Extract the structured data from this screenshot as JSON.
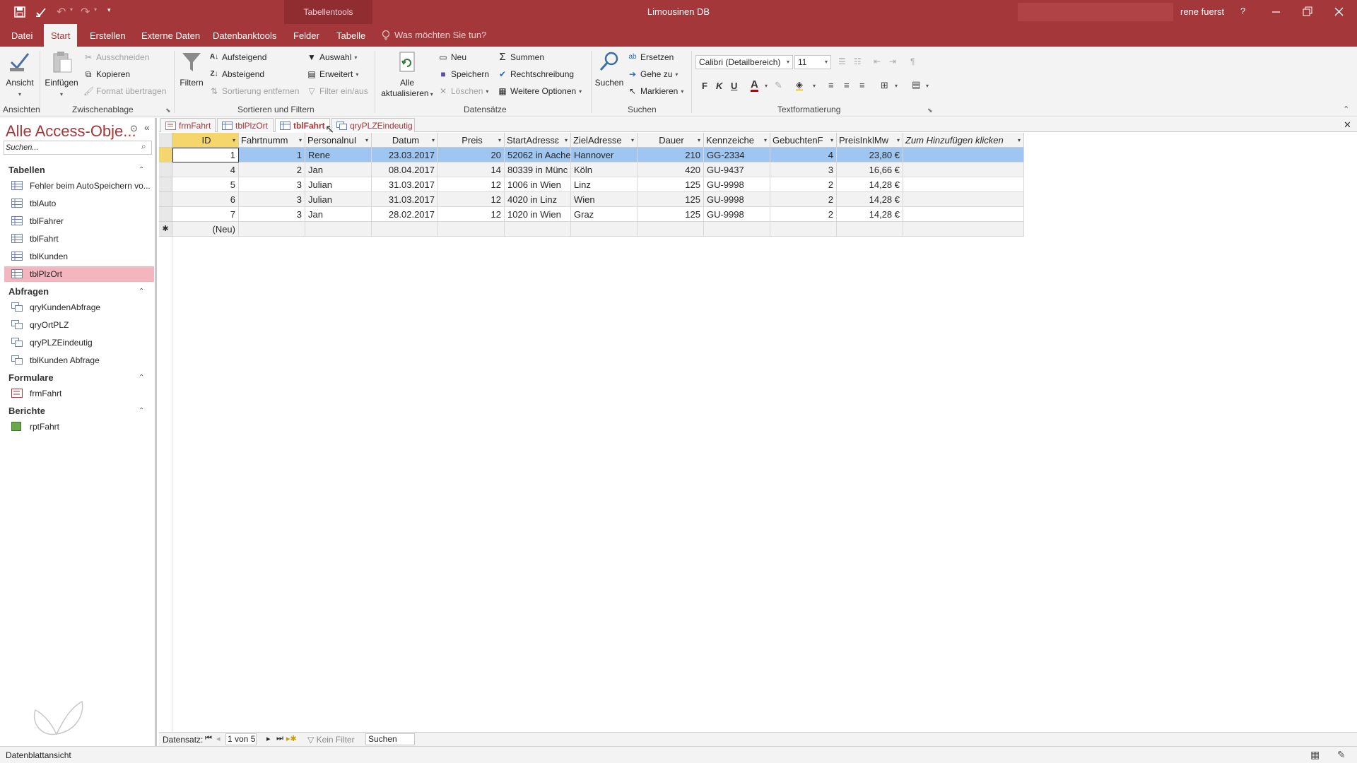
{
  "window": {
    "title": "Limousinen DB",
    "context_tab": "Tabellentools",
    "user": "rene fuerst",
    "help": "?",
    "qat_customize": "▾"
  },
  "tabs": {
    "file": "Datei",
    "home": "Start",
    "create": "Erstellen",
    "external": "Externe Daten",
    "dbtools": "Datenbanktools",
    "fields": "Felder",
    "table": "Tabelle",
    "tellme": "Was möchten Sie tun?"
  },
  "ribbon": {
    "view": "Ansicht",
    "paste": "Einfügen",
    "cut": "Ausschneiden",
    "copy": "Kopieren",
    "format_painter": "Format übertragen",
    "filter": "Filtern",
    "ascending": "Aufsteigend",
    "descending": "Absteigend",
    "remove_sort": "Sortierung entfernen",
    "selection": "Auswahl",
    "advanced": "Erweitert",
    "toggle_filter": "Filter ein/aus",
    "refresh_line1": "Alle",
    "refresh_line2": "aktualisieren",
    "new": "Neu",
    "save": "Speichern",
    "delete": "Löschen",
    "totals": "Summen",
    "spelling": "Rechtschreibung",
    "more": "Weitere Optionen",
    "find": "Suchen",
    "replace": "Ersetzen",
    "goto": "Gehe zu",
    "select": "Markieren",
    "font_name": "Calibri (Detailbereich)",
    "font_size": "11",
    "bold": "F",
    "italic": "K",
    "underline": "U",
    "font_color_letter": "A",
    "groups": {
      "views": "Ansichten",
      "clipboard": "Zwischenablage",
      "sort_filter": "Sortieren und Filtern",
      "records": "Datensätze",
      "find": "Suchen",
      "text_format": "Textformatierung"
    }
  },
  "nav": {
    "title": "Alle Access-Obje...",
    "search_placeholder": "Suchen...",
    "sections": [
      {
        "title": "Tabellen",
        "items": [
          "Fehler beim AutoSpeichern vo...",
          "tblAuto",
          "tblFahrer",
          "tblFahrt",
          "tblKunden",
          "tblPlzOrt"
        ]
      },
      {
        "title": "Abfragen",
        "items": [
          "qryKundenAbfrage",
          "qryOrtPLZ",
          "qryPLZEindeutig",
          "tblKunden Abfrage"
        ]
      },
      {
        "title": "Formulare",
        "items": [
          "frmFahrt"
        ]
      },
      {
        "title": "Berichte",
        "items": [
          "rptFahrt"
        ]
      }
    ]
  },
  "doc_tabs": [
    "frmFahrt",
    "tblPlzOrt",
    "tblFahrt",
    "qryPLZEindeutig"
  ],
  "table": {
    "columns": [
      "ID",
      "Fahrtnumm",
      "PersonalnuI",
      "Datum",
      "Preis",
      "StartAdressɛ",
      "ZielAdresse",
      "Dauer",
      "Kennzeiche",
      "GebuchtenF",
      "PreisInklMw",
      "Zum Hinzufügen klicken"
    ],
    "rows": [
      [
        "1",
        "1",
        "Rene",
        "23.03.2017",
        "20",
        "52062 in Aache",
        "Hannover",
        "210",
        "GG-2334",
        "4",
        "23,80 €",
        ""
      ],
      [
        "4",
        "2",
        "Jan",
        "08.04.2017",
        "14",
        "80339 in Münc",
        "Köln",
        "420",
        "GU-9437",
        "3",
        "16,66 €",
        ""
      ],
      [
        "5",
        "3",
        "Julian",
        "31.03.2017",
        "12",
        "1006 in Wien",
        "Linz",
        "125",
        "GU-9998",
        "2",
        "14,28 €",
        ""
      ],
      [
        "6",
        "3",
        "Julian",
        "31.03.2017",
        "12",
        "4020 in Linz",
        "Wien",
        "125",
        "GU-9998",
        "2",
        "14,28 €",
        ""
      ],
      [
        "7",
        "3",
        "Jan",
        "28.02.2017",
        "12",
        "1020 in Wien",
        "Graz",
        "125",
        "GU-9998",
        "2",
        "14,28 €",
        ""
      ]
    ],
    "new_row": "(Neu)",
    "new_row_marker": "✱"
  },
  "record_nav": {
    "label": "Datensatz:",
    "position": "1 von 5",
    "filter": "Kein Filter",
    "search": "Suchen"
  },
  "status": {
    "text": "Datenblattansicht"
  },
  "colors": {
    "accent": "#a4373a",
    "selected_row": "#9fc6f0",
    "selected_nav": "#f4b6be",
    "header_active": "#f5d66d"
  }
}
